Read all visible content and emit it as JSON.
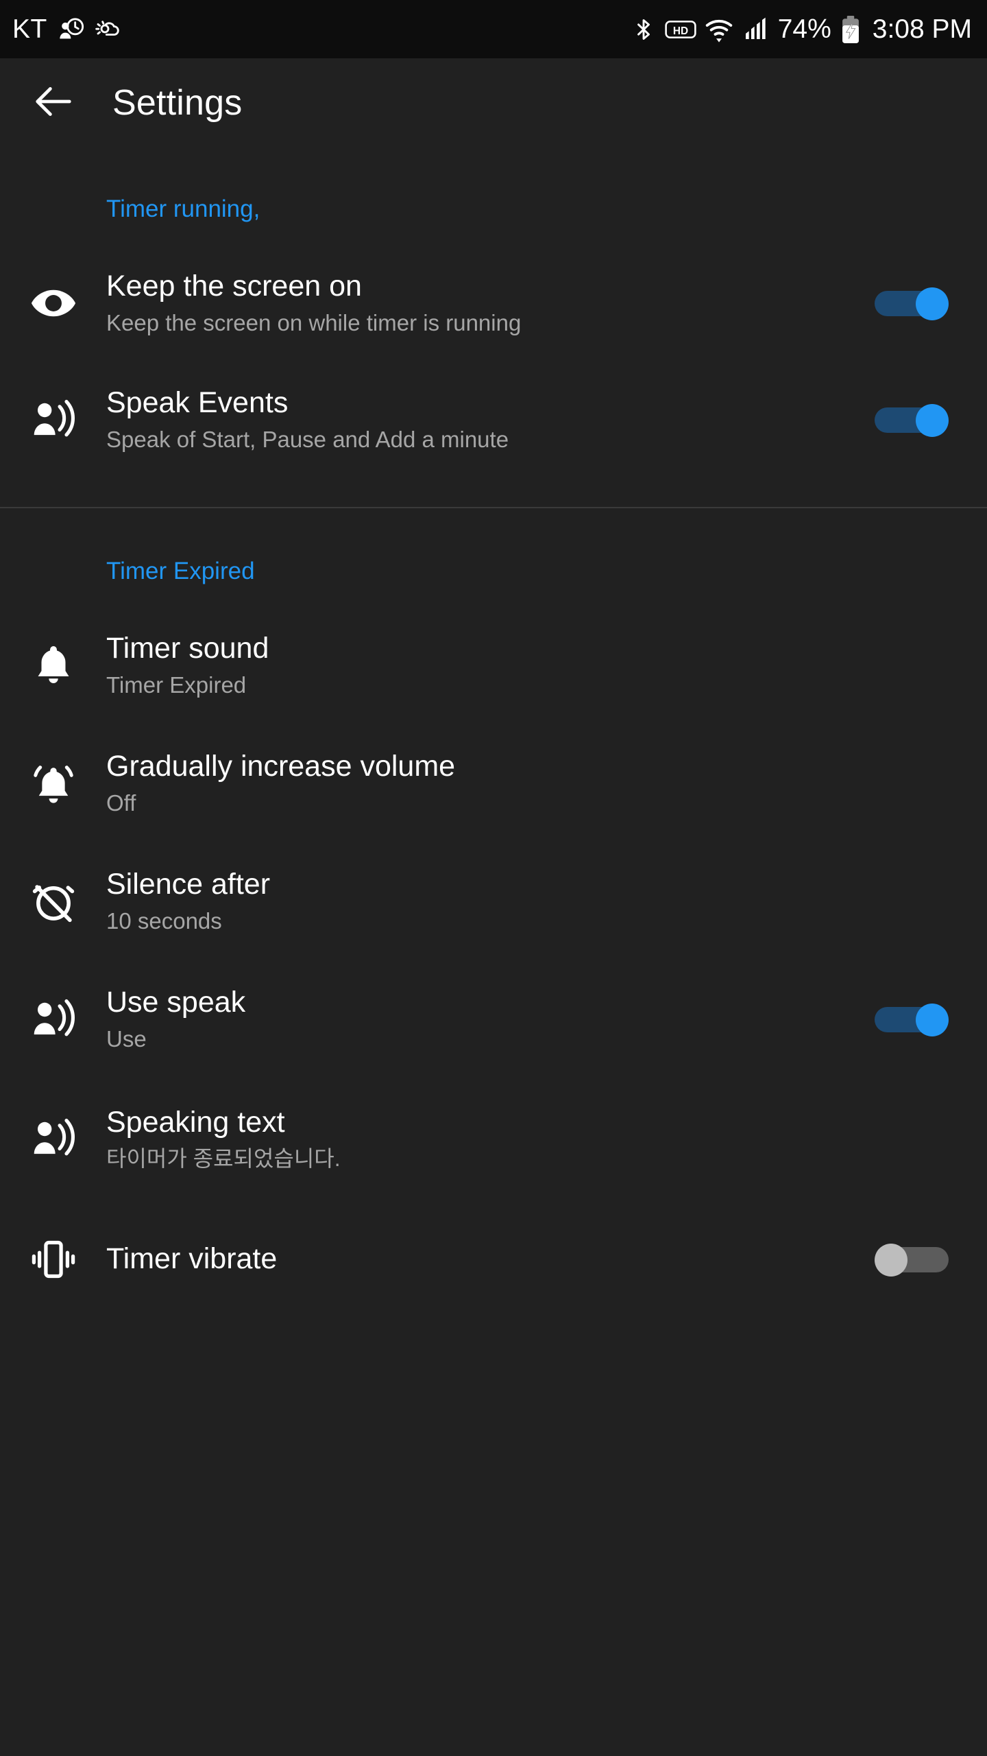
{
  "status_bar": {
    "carrier": "KT",
    "left_icons": [
      "person-clock-icon",
      "weather-partly-cloudy-icon"
    ],
    "right_icons": [
      "bluetooth-icon",
      "hd-icon",
      "wifi-icon",
      "cellular-signal-icon"
    ],
    "battery_percent": "74%",
    "battery_state": "charging",
    "time": "3:08 PM"
  },
  "appbar": {
    "back_icon": "arrow-back-icon",
    "title": "Settings"
  },
  "colors": {
    "accent": "#2196f3",
    "background": "#212121",
    "statusbar_bg": "#0d0d0d",
    "title_text": "#ffffff",
    "subtitle_text": "#a6a6a6",
    "divider": "#3a3a3a",
    "toggle_on_track": "#1d4a73",
    "toggle_on_thumb": "#2196f3",
    "toggle_off_track": "#5c5c5c",
    "toggle_off_thumb": "#bdbdbd"
  },
  "sections": [
    {
      "header": "Timer running,",
      "rows": [
        {
          "icon": "eye-icon",
          "title": "Keep the screen on",
          "subtitle": "Keep the screen on while timer is running",
          "control": "toggle",
          "toggle_state": "on"
        },
        {
          "icon": "record-voice-over-icon",
          "title": "Speak Events",
          "subtitle": "Speak of Start, Pause and Add a minute",
          "control": "toggle",
          "toggle_state": "on"
        }
      ]
    },
    {
      "header": "Timer Expired",
      "rows": [
        {
          "icon": "notifications-bell-icon",
          "title": "Timer sound",
          "subtitle": "Timer Expired",
          "control": "none",
          "toggle_state": ""
        },
        {
          "icon": "notifications-active-bell-icon",
          "title": "Gradually increase volume",
          "subtitle": "Off",
          "control": "none",
          "toggle_state": ""
        },
        {
          "icon": "alarm-off-icon",
          "title": "Silence after",
          "subtitle": "10 seconds",
          "control": "none",
          "toggle_state": ""
        },
        {
          "icon": "record-voice-over-icon",
          "title": "Use speak",
          "subtitle": "Use",
          "control": "toggle",
          "toggle_state": "on"
        },
        {
          "icon": "record-voice-over-icon",
          "title": "Speaking text",
          "subtitle": "타이머가 종료되었습니다.",
          "control": "none",
          "toggle_state": ""
        },
        {
          "icon": "vibration-icon",
          "title": "Timer vibrate",
          "subtitle": "",
          "control": "toggle",
          "toggle_state": "off"
        }
      ]
    }
  ]
}
